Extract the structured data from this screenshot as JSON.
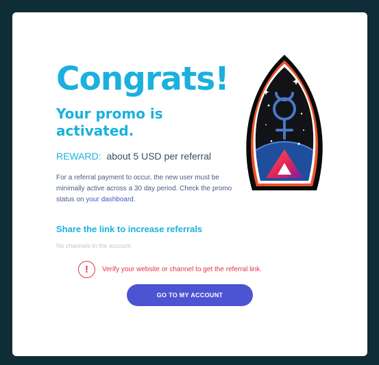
{
  "promo": {
    "headline": "Congrats!",
    "subhead": "Your promo is activated.",
    "reward_label": "REWARD:",
    "reward_value": "about 5 USD per referral",
    "description_text": "For a referral payment to occur, the new user must be minimally active across a 30 day period. Check the promo status on ",
    "dashboard_link": "your dashboard",
    "description_end": "."
  },
  "share": {
    "title": "Share the link to increase referrals",
    "no_channels": "No channels in the account."
  },
  "verify": {
    "icon": "exclamation-alert-icon",
    "text": "Verify your website or channel to get the referral link."
  },
  "actions": {
    "account_button": "GO TO MY ACCOUNT"
  },
  "badge": {
    "icon": "rocket-venus-badge-icon"
  },
  "colors": {
    "page_background": "#0e2d36",
    "accent_cyan": "#1bb0dd",
    "button": "#4c54d2",
    "alert": "#e0334b"
  }
}
